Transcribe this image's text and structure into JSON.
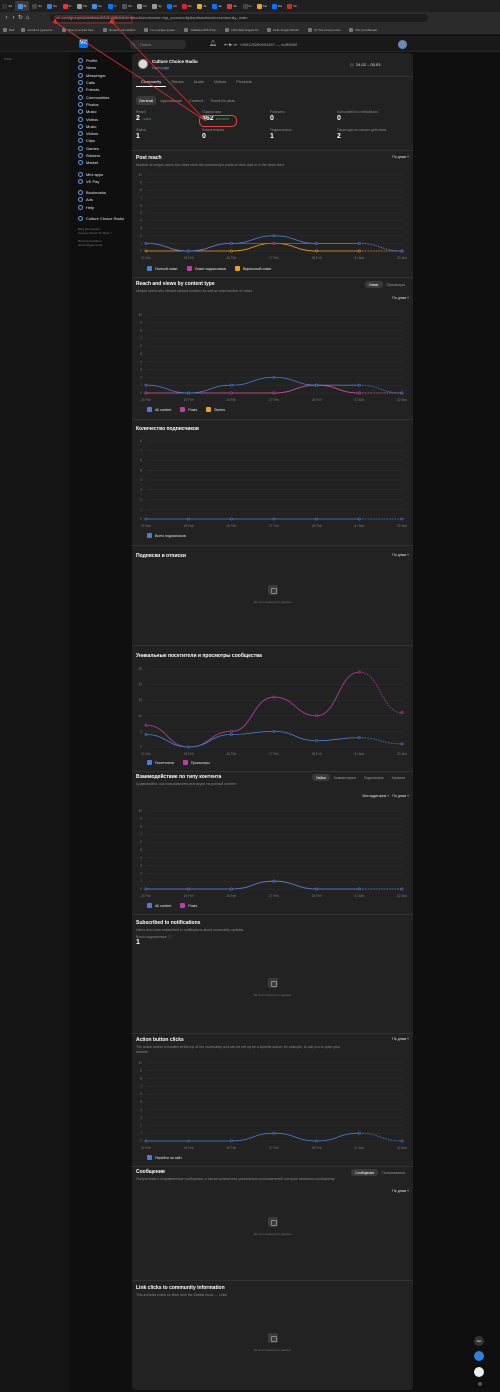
{
  "browser": {
    "tabs": [
      "ЗЗ",
      "Ві",
      "Зв",
      "Sa",
      "Pr",
      "Fili",
      "Ne",
      "Yt",
      "Sh",
      "Fil",
      "Sp",
      "Ка",
      "Ви",
      "Зе",
      "Эк",
      "Эк",
      "Gi",
      "Ыо",
      "Ма",
      "Ок"
    ],
    "tab_colors": [
      "#333",
      "#4a90e2",
      "#444",
      "#3b7dd8",
      "#e33",
      "#999",
      "#4a90e2",
      "#0077ff",
      "#555",
      "#999",
      "#999",
      "#0077ff",
      "#d23",
      "#e0a93a",
      "#0077ff",
      "#c44",
      "#444",
      "#e0a93a",
      "#0077ff",
      "#b33"
    ],
    "url": "vk.com/groups/dashboard/&/&/cultchoiceradio/&/sections/e=top_community&subsectionId=community_main",
    "bookmarks": [
      "Веб",
      "eccaticul | gaxerne...",
      "How to embed free...",
      "Уровни | cfnnavikrd...",
      "Le musique qudes...",
      "YaMasta APK B Ap...",
      "(15) Hello Angels M...",
      "Hello Angels World...",
      "(7) The Anonymous...",
      "Рис для Вашей"
    ]
  },
  "vk": {
    "search_placeholder": "Поиск",
    "player_text": "+00012026000145? — noR5000"
  },
  "left_note": "Stock",
  "sidebar": {
    "items": [
      {
        "label": "Profile"
      },
      {
        "label": "News"
      },
      {
        "label": "Messenger"
      },
      {
        "label": "Calls"
      },
      {
        "label": "Friends"
      },
      {
        "label": "Communities"
      },
      {
        "label": "Photos"
      },
      {
        "label": "Music"
      },
      {
        "label": "Videos"
      },
      {
        "label": "Music"
      },
      {
        "label": "Videos"
      },
      {
        "label": "Clips"
      },
      {
        "label": "Games"
      },
      {
        "label": "Stickers"
      },
      {
        "label": "Market"
      }
    ],
    "items2": [
      {
        "label": "Mini apps"
      },
      {
        "label": "VK Pay"
      }
    ],
    "items3": [
      {
        "label": "Bookmarks"
      },
      {
        "label": "Ads"
      },
      {
        "label": "Help"
      }
    ],
    "items4": [
      {
        "label": "Culture Choice Radio"
      }
    ],
    "footer": "Blog   Developers\nCareers   About VK   More ˅",
    "footer2": "Recommendation\ntechnologies used"
  },
  "community": {
    "name": "Culture Choice Radio",
    "link": "Open page",
    "dates": "24.02 – 03.03",
    "tabs": [
      "Community",
      "Stories",
      "Audio",
      "Videos",
      "Products"
    ],
    "subtabs": [
      "General",
      "Appearance",
      "Content",
      "Trend for year"
    ]
  },
  "stats": {
    "reach": {
      "label": "Reach",
      "value": "2",
      "delta": "↑100%"
    },
    "subscribers": {
      "label": "Подписчики",
      "value": "462",
      "delta": "100.000%"
    },
    "followers": {
      "label": "Followers",
      "value": "0",
      "delta": "–"
    },
    "notif": {
      "label": "Subscribed to notifications",
      "value": "0",
      "delta": "–"
    },
    "likes": {
      "label": "Лайки",
      "value": "1",
      "delta": ""
    },
    "comments": {
      "label": "Комментарии",
      "value": "0",
      "delta": "–"
    },
    "reposts": {
      "label": "Подписались",
      "value": "1",
      "delta": ""
    },
    "actions": {
      "label": "Переходы по кнопке действия",
      "value": "2",
      "delta": ""
    }
  },
  "sections": {
    "post_reach": {
      "title": "Post reach",
      "sub": "Number of unique users who have seen the community's posts on their wall or in the news feed",
      "right": "По дням ˅",
      "legend": [
        {
          "label": "Полный охват",
          "color": "#4a7fd1"
        },
        {
          "label": "Охват подписчиков",
          "color": "#b93ea5"
        },
        {
          "label": "Виральный охват",
          "color": "#f0a028"
        }
      ]
    },
    "reach_views": {
      "title": "Reach and views by content type",
      "sub": "Unique users who viewed various content, as well as total number of views",
      "seg": [
        "Охват",
        "Просмотры"
      ],
      "right": "По дням ˅",
      "legend": [
        {
          "label": "All content",
          "color": "#4a7fd1"
        },
        {
          "label": "Posts",
          "color": "#b93ea5"
        },
        {
          "label": "Stories",
          "color": "#f0a028"
        }
      ]
    },
    "subscribers_count": {
      "title": "Количество подписчиков",
      "legend": [
        {
          "label": "Всего подписчиков",
          "color": "#4a7fd1"
        }
      ]
    },
    "subs_unsubs": {
      "title": "Подписки и отписки",
      "right": "По дням ˅",
      "empty": "За этот период нет данных"
    },
    "visitors": {
      "title": "Уникальные посетители и просмотры сообщества",
      "legend": [
        {
          "label": "Посетители",
          "color": "#4a7fd1"
        },
        {
          "label": "Просмотры",
          "color": "#b93ea5"
        }
      ]
    },
    "interaction": {
      "title": "Взаимодействие по типу контента",
      "sub": "Сравнивайте, как пользователи реагируют на разный контент",
      "seg": [
        "Лайки",
        "Комментарии",
        "Поделились",
        "Корзина"
      ],
      "right": "По дням ˅",
      "audience": "Вся аудитория ˅",
      "legend": [
        {
          "label": "All content",
          "color": "#4a7fd1"
        },
        {
          "label": "Posts",
          "color": "#b93ea5"
        }
      ]
    },
    "notifications": {
      "title": "Subscribed to notifications",
      "sub": "Users who have subscribed to notifications about community updates",
      "total_label": "Всего подписались ⓘ",
      "total": "1",
      "empty": "За этот период нет данных"
    },
    "action_clicks": {
      "title": "Action button clicks",
      "sub": "The action button is located at the top of the community and can be set up for a specific action, for example, to call you or open your website.",
      "right": "По дням ˅",
      "legend": [
        {
          "label": "Перейти на сайт",
          "color": "#4a7fd1"
        }
      ]
    },
    "messages": {
      "title": "Сообщения",
      "sub": "Полученные и отправленные сообщения, а так же количество уникальных пользователей, которые написали сообществу",
      "seg": [
        "Сообщения",
        "Пользователи"
      ],
      "right": "По дням ˅",
      "empty": "За этот период нет данных"
    },
    "link_clicks": {
      "title": "Link clicks to community information",
      "sub": "This includes clicks on links from the Details block — Links",
      "empty": "За этот период нет данных"
    }
  },
  "floating": {
    "label": "two"
  },
  "chart_data": [
    {
      "type": "line",
      "title": "Post reach",
      "x": [
        "24 Feb",
        "25 Feb",
        "26 Feb",
        "27 Feb",
        "28 Feb",
        "01 Mar",
        "02 Mar"
      ],
      "ylim": [
        0,
        10
      ],
      "series": [
        {
          "name": "Полный охват",
          "values": [
            1,
            0,
            1,
            2,
            1,
            1,
            0
          ]
        },
        {
          "name": "Охват подписчиков",
          "values": [
            1,
            0,
            1,
            1,
            1,
            1,
            0
          ]
        },
        {
          "name": "Виральный охват",
          "values": [
            0,
            0,
            0,
            1,
            0,
            0,
            0
          ]
        }
      ]
    },
    {
      "type": "line",
      "title": "Reach and views by content type",
      "x": [
        "24 Feb",
        "25 Feb",
        "26 Feb",
        "27 Feb",
        "28 Feb",
        "01 Mar",
        "02 Mar"
      ],
      "ylim": [
        0,
        10
      ],
      "series": [
        {
          "name": "All content",
          "values": [
            1,
            0,
            1,
            2,
            1,
            1,
            0
          ]
        },
        {
          "name": "Posts",
          "values": [
            0,
            0,
            0,
            0,
            1,
            0,
            0
          ]
        },
        {
          "name": "Stories",
          "values": [
            0,
            0,
            0,
            0,
            1,
            0,
            0
          ]
        }
      ]
    },
    {
      "type": "line",
      "title": "Количество подписчиков",
      "x": [
        "24 Feb",
        "25 Feb",
        "26 Feb",
        "27 Feb",
        "28 Feb",
        "01 Mar",
        "02 Mar"
      ],
      "ylim": [
        0,
        8
      ],
      "series": [
        {
          "name": "Всего подписчиков",
          "values": [
            0,
            0,
            0,
            0,
            0,
            0,
            0
          ]
        }
      ]
    },
    {
      "type": "line",
      "title": "Уникальные посетители и просмотры сообщества",
      "x": [
        "24 Feb",
        "25 Feb",
        "26 Feb",
        "27 Feb",
        "28 Feb",
        "01 Mar",
        "02 Mar"
      ],
      "ylim": [
        0,
        25
      ],
      "series": [
        {
          "name": "Посетители",
          "values": [
            4,
            0,
            4,
            5,
            2,
            3,
            1
          ]
        },
        {
          "name": "Просмотры",
          "values": [
            7,
            0,
            5,
            16,
            10,
            24,
            11
          ]
        }
      ]
    },
    {
      "type": "line",
      "title": "Взаимодействие по типу контента",
      "x": [
        "24 Feb",
        "25 Feb",
        "26 Feb",
        "27 Feb",
        "28 Feb",
        "01 Mar",
        "02 Mar"
      ],
      "ylim": [
        0,
        10
      ],
      "series": [
        {
          "name": "All content",
          "values": [
            0,
            0,
            0,
            1,
            0,
            0,
            0
          ]
        },
        {
          "name": "Posts",
          "values": [
            0,
            0,
            0,
            1,
            0,
            0,
            0
          ]
        }
      ]
    },
    {
      "type": "line",
      "title": "Action button clicks",
      "x": [
        "24 Feb",
        "25 Feb",
        "26 Feb",
        "27 Feb",
        "28 Feb",
        "01 Mar",
        "02 Mar"
      ],
      "ylim": [
        0,
        10
      ],
      "series": [
        {
          "name": "Перейти на сайт",
          "values": [
            0,
            0,
            0,
            1,
            0,
            1,
            0
          ]
        }
      ]
    }
  ]
}
